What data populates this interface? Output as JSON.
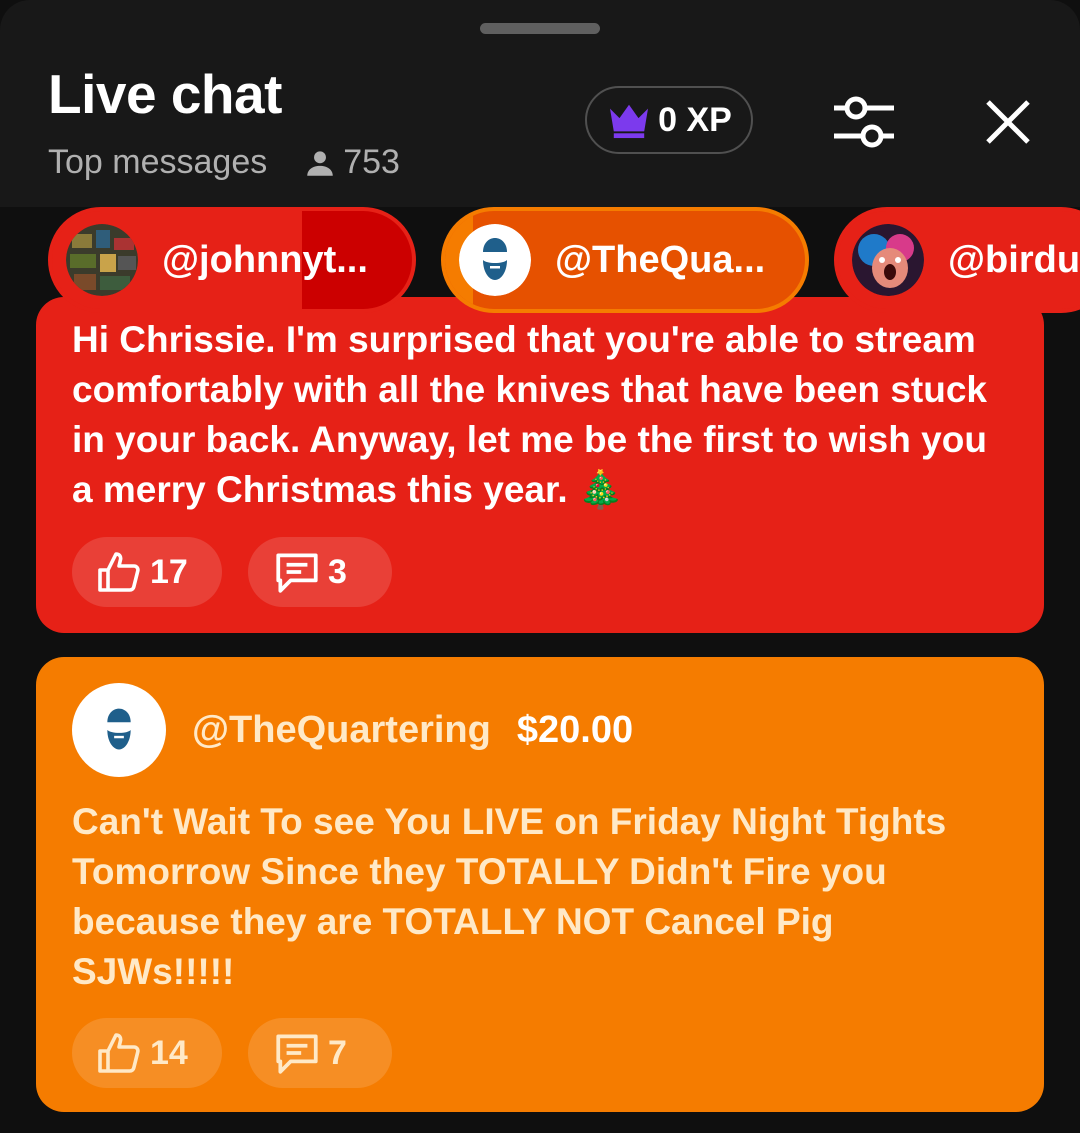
{
  "header": {
    "title": "Live chat",
    "mode": "Top messages",
    "viewer_count": "753",
    "xp": "0 XP"
  },
  "icons": {
    "viewers": "person-icon",
    "xp": "crown-icon",
    "settings": "tune-icon",
    "close": "close-icon",
    "like": "thumb-up-icon",
    "reply": "comment-icon"
  },
  "colors": {
    "red": "#e62117",
    "orange": "#f57c00",
    "crown": "#7c3aed"
  },
  "pinned": [
    {
      "handle": "@johnnyt..."
    },
    {
      "handle": "@TheQua..."
    },
    {
      "handle": "@birdu"
    }
  ],
  "messages": [
    {
      "text": "Hi Chrissie. I'm surprised that you're able to stream comfortably with all the knives that have been stuck in your back. Anyway, let me be the first to wish you a merry Christmas this year. 🎄",
      "likes": "17",
      "replies": "3"
    },
    {
      "author": "@TheQuartering",
      "amount": "$20.00",
      "text": "Can't Wait To see You LIVE on Friday Night Tights Tomorrow Since they TOTALLY Didn't Fire you because they are TOTALLY NOT Cancel Pig SJWs!!!!!",
      "likes": "14",
      "replies": "7"
    }
  ]
}
